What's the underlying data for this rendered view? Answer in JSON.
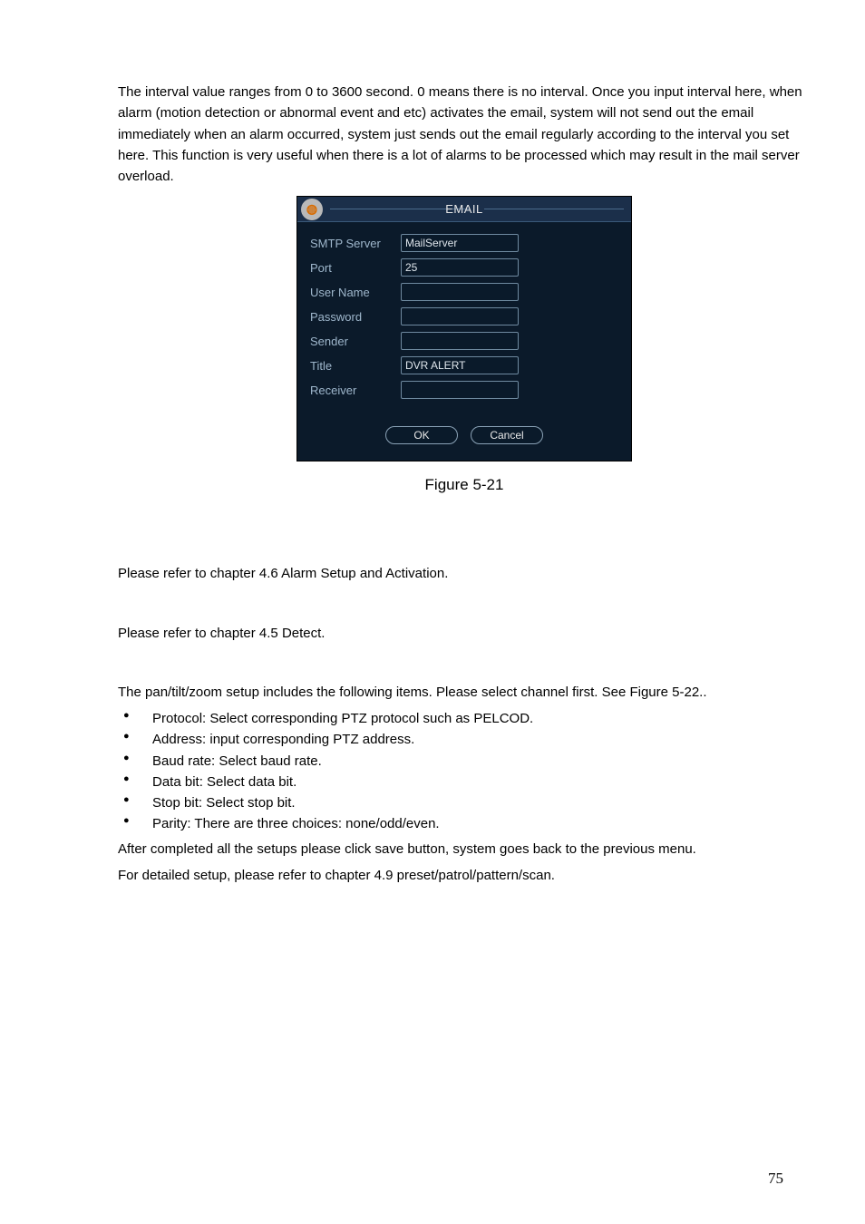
{
  "intro_paragraph": "The interval value ranges from 0 to 3600 second. 0 means there is no interval. Once you input interval here, when alarm (motion detection or abnormal event and etc) activates the email, system will not send out the email immediately when an alarm occurred, system just sends out the email regularly according to the interval you set here. This function is very useful when there is a lot of alarms to be processed which may result in the mail server overload.",
  "dialog": {
    "title": "EMAIL",
    "fields": {
      "smtp_server": {
        "label": "SMTP Server",
        "value": "MailServer"
      },
      "port": {
        "label": "Port",
        "value": "25"
      },
      "user_name": {
        "label": "User Name",
        "value": ""
      },
      "password": {
        "label": "Password",
        "value": ""
      },
      "sender": {
        "label": "Sender",
        "value": ""
      },
      "title": {
        "label": "Title",
        "value": "DVR ALERT"
      },
      "receiver": {
        "label": "Receiver",
        "value": ""
      }
    },
    "buttons": {
      "ok": "OK",
      "cancel": "Cancel"
    }
  },
  "figure_caption": "Figure 5-21",
  "section_alarm": "Please refer to chapter 4.6 Alarm Setup and Activation.",
  "section_detect": "Please refer to chapter 4.5 Detect.",
  "ptz_intro": "The pan/tilt/zoom setup includes the following items. Please select channel first. See Figure 5-22..",
  "ptz_bullets": [
    "Protocol: Select corresponding PTZ protocol such as PELCOD.",
    "Address: input corresponding PTZ address.",
    "Baud rate: Select baud rate.",
    "Data bit: Select data bit.",
    "Stop bit: Select stop bit.",
    "Parity: There are three choices: none/odd/even."
  ],
  "ptz_outro1": "After completed all the setups please click save button, system goes back to the previous menu.",
  "ptz_outro2": "For detailed setup, please refer to chapter 4.9 preset/patrol/pattern/scan.",
  "page_number": "75"
}
